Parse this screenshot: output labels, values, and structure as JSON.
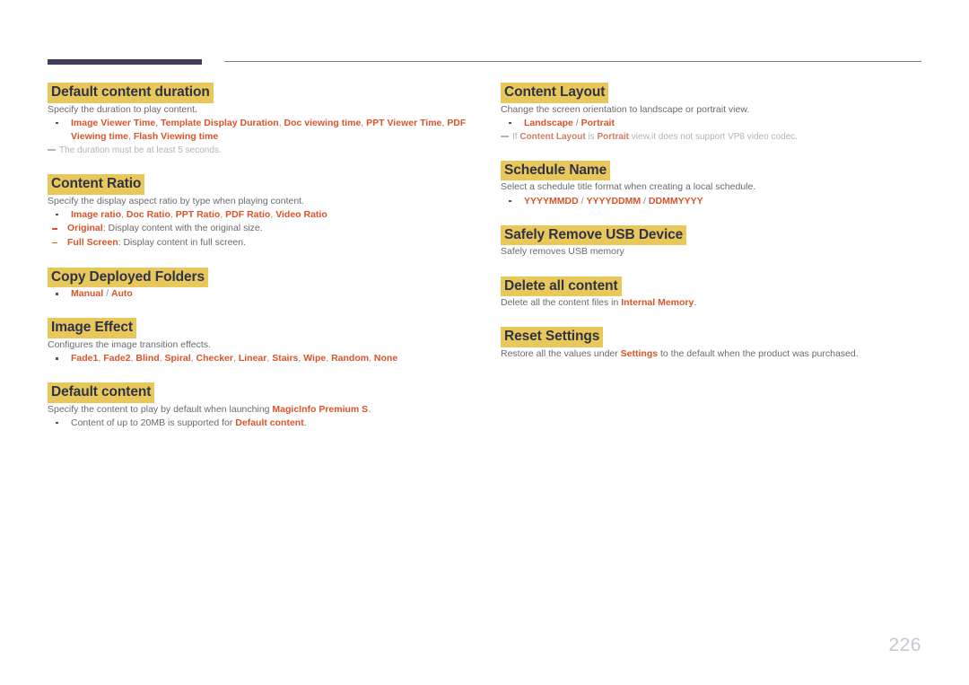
{
  "page": {
    "number": "226"
  },
  "left_column": [
    {
      "id": "default-content-duration",
      "heading": "Default content duration",
      "desc": "Specify the duration to play content.",
      "bullet_parts": [
        {
          "t": "Image Viewer Time",
          "s": "red"
        },
        {
          "t": ", ",
          "s": "sep"
        },
        {
          "t": "Template Display Duration",
          "s": "red"
        },
        {
          "t": ", ",
          "s": "sep"
        },
        {
          "t": "Doc viewing time",
          "s": "red"
        },
        {
          "t": ", ",
          "s": "sep"
        },
        {
          "t": "PPT Viewer Time",
          "s": "red"
        },
        {
          "t": ", ",
          "s": "sep"
        },
        {
          "t": "PDF Viewing time",
          "s": "red"
        },
        {
          "t": ", ",
          "s": "sep"
        },
        {
          "t": "Flash Viewing time",
          "s": "red"
        }
      ],
      "note": "The duration must be at least 5 seconds."
    },
    {
      "id": "content-ratio",
      "heading": "Content Ratio",
      "desc": "Specify the display aspect ratio by type when playing content.",
      "bullet_parts": [
        {
          "t": "Image ratio",
          "s": "red"
        },
        {
          "t": ", ",
          "s": "sep"
        },
        {
          "t": "Doc Ratio",
          "s": "red"
        },
        {
          "t": ", ",
          "s": "sep"
        },
        {
          "t": "PPT Ratio",
          "s": "red"
        },
        {
          "t": ", ",
          "s": "sep"
        },
        {
          "t": "PDF Ratio",
          "s": "red"
        },
        {
          "t": ", ",
          "s": "sep"
        },
        {
          "t": "Video Ratio",
          "s": "red"
        }
      ],
      "subs": [
        {
          "term": "Original",
          "text": ": Display content with the original size."
        },
        {
          "term": "Full Screen",
          "text": ": Display content in full screen."
        }
      ]
    },
    {
      "id": "copy-deployed-folders",
      "heading": "Copy Deployed Folders",
      "bullet_parts": [
        {
          "t": "Manual",
          "s": "red"
        },
        {
          "t": " / ",
          "s": "sep"
        },
        {
          "t": "Auto",
          "s": "red"
        }
      ]
    },
    {
      "id": "image-effect",
      "heading": "Image Effect",
      "desc": "Configures the image transition effects.",
      "bullet_parts": [
        {
          "t": "Fade1",
          "s": "red"
        },
        {
          "t": ", ",
          "s": "sep"
        },
        {
          "t": "Fade2",
          "s": "red"
        },
        {
          "t": ", ",
          "s": "sep"
        },
        {
          "t": "Blind",
          "s": "red"
        },
        {
          "t": ", ",
          "s": "sep"
        },
        {
          "t": "Spiral",
          "s": "red"
        },
        {
          "t": ", ",
          "s": "sep"
        },
        {
          "t": "Checker",
          "s": "red"
        },
        {
          "t": ", ",
          "s": "sep"
        },
        {
          "t": "Linear",
          "s": "red"
        },
        {
          "t": ", ",
          "s": "sep"
        },
        {
          "t": "Stairs",
          "s": "red"
        },
        {
          "t": ", ",
          "s": "sep"
        },
        {
          "t": "Wipe",
          "s": "red"
        },
        {
          "t": ", ",
          "s": "sep"
        },
        {
          "t": "Random",
          "s": "red"
        },
        {
          "t": ", ",
          "s": "sep"
        },
        {
          "t": "None",
          "s": "red"
        }
      ]
    },
    {
      "id": "default-content",
      "heading": "Default content",
      "desc_parts": [
        {
          "t": "Specify the content to play by default when launching ",
          "s": "gray"
        },
        {
          "t": "MagicInfo Premium S",
          "s": "red"
        },
        {
          "t": ".",
          "s": "gray"
        }
      ],
      "bullet_parts": [
        {
          "t": "Content of up to 20MB is supported for ",
          "s": "gray"
        },
        {
          "t": "Default content",
          "s": "red"
        },
        {
          "t": ".",
          "s": "gray"
        }
      ]
    }
  ],
  "right_column": [
    {
      "id": "content-layout",
      "heading": "Content Layout",
      "desc": "Change the screen orientation to landscape or portrait view.",
      "bullet_parts": [
        {
          "t": "Landscape",
          "s": "red"
        },
        {
          "t": " / ",
          "s": "sep"
        },
        {
          "t": "Portrait",
          "s": "red"
        }
      ],
      "note_parts": [
        {
          "t": "If ",
          "s": "g"
        },
        {
          "t": "Content Layout",
          "s": "k"
        },
        {
          "t": " is ",
          "s": "g"
        },
        {
          "t": "Portrait",
          "s": "k"
        },
        {
          "t": " view,it does not support VP8 video codec.",
          "s": "g"
        }
      ]
    },
    {
      "id": "schedule-name",
      "heading": "Schedule Name",
      "desc": "Select a schedule title format when creating a local schedule.",
      "bullet_parts": [
        {
          "t": "YYYYMMDD",
          "s": "red"
        },
        {
          "t": " / ",
          "s": "sep"
        },
        {
          "t": "YYYYDDMM",
          "s": "red"
        },
        {
          "t": " / ",
          "s": "sep"
        },
        {
          "t": "DDMMYYYY",
          "s": "red"
        }
      ]
    },
    {
      "id": "safely-remove-usb-device",
      "heading": "Safely Remove USB Device",
      "desc": "Safely removes USB memory"
    },
    {
      "id": "delete-all-content",
      "heading": "Delete all content",
      "desc_parts": [
        {
          "t": "Delete all the content files in ",
          "s": "gray"
        },
        {
          "t": "Internal Memory",
          "s": "red"
        },
        {
          "t": ".",
          "s": "gray"
        }
      ]
    },
    {
      "id": "reset-settings",
      "heading": "Reset Settings",
      "desc_parts": [
        {
          "t": "Restore all the values under ",
          "s": "gray"
        },
        {
          "t": "Settings",
          "s": "red"
        },
        {
          "t": " to the default when the product was purchased.",
          "s": "gray"
        }
      ]
    }
  ]
}
